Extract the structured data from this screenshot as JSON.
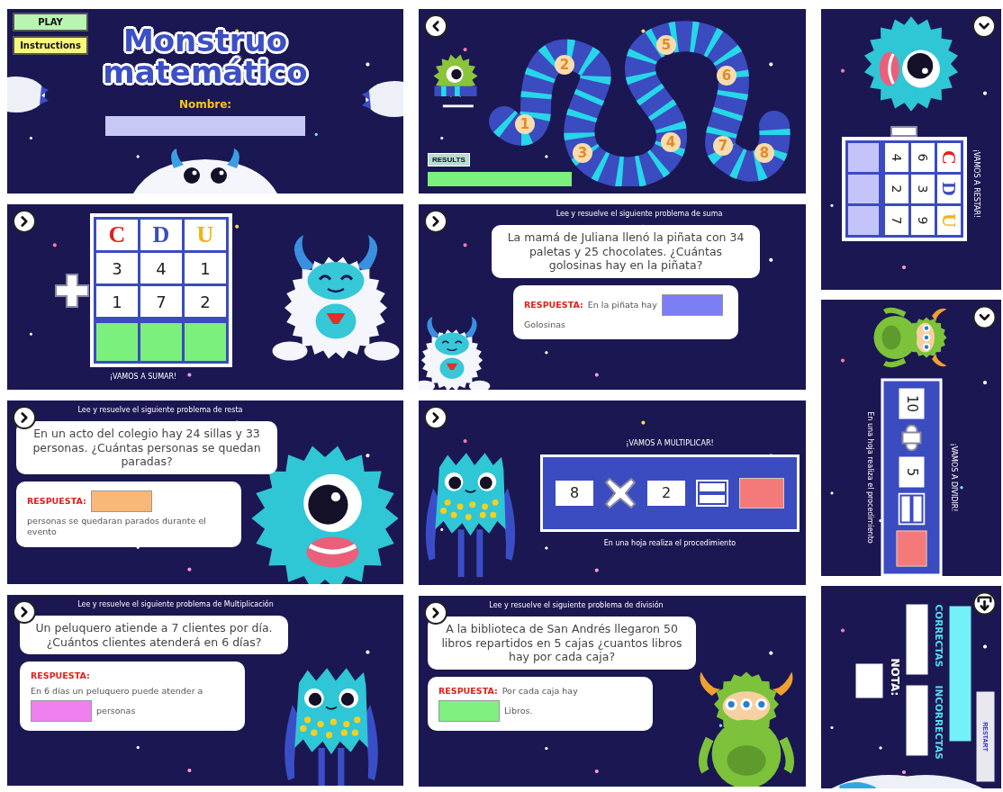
{
  "columns": [
    [
      {
        "kind": "title",
        "rotated": false,
        "buttons": [
          {
            "label": "PLAY",
            "color": "#b8f5b0"
          },
          {
            "label": "Instructions",
            "color": "#f8f87a"
          }
        ],
        "title_lines": [
          "Monstruo",
          "matemático"
        ],
        "field_label": "Nombre:"
      },
      {
        "kind": "column_operation",
        "rotated": false,
        "nav": {
          "kind": "next"
        },
        "operator": {
          "kind": "plus"
        },
        "place_values": [
          {
            "letter": "C",
            "color": "#e0201c",
            "digits": [
              "3",
              "1"
            ]
          },
          {
            "letter": "D",
            "color": "#3b4bc0",
            "digits": [
              "4",
              "7"
            ]
          },
          {
            "letter": "U",
            "color": "#f2b400",
            "digits": [
              "1",
              "2"
            ]
          }
        ],
        "answer_box": {
          "color": "#7cf07c"
        },
        "caption": "¡VAMOS A SUMAR!"
      },
      {
        "kind": "word_problem",
        "rotated": false,
        "nav": {
          "kind": "next"
        },
        "instruction": "Lee y resuelve el siguiente problema de resta",
        "question": "En un acto del colegio hay 24 sillas y 33 personas. ¿Cuántas personas se quedan paradas?",
        "answer_label": "RESPUESTA:",
        "answer_after": "personas se quedaran parados durante el evento",
        "answer_box": {
          "color": "#f8b878"
        }
      },
      {
        "kind": "word_problem",
        "rotated": false,
        "nav": {
          "kind": "next"
        },
        "instruction": "Lee y resuelve el siguiente problema de Multiplicación",
        "question": "Un peluquero atiende a 7 clientes por día. ¿Cuántos clientes atenderá en 6 días?",
        "answer_label": "RESPUESTA:",
        "answer_before": "En 6 días un peluquero puede atender a",
        "answer_after": "personas",
        "answer_box": {
          "color": "#f080f0"
        }
      }
    ],
    [
      {
        "kind": "map",
        "rotated": false,
        "nav": {
          "kind": "back"
        },
        "steps": [
          "1",
          "2",
          "3",
          "4",
          "5",
          "6",
          "7",
          "8"
        ],
        "button": "RESULTS"
      },
      {
        "kind": "word_problem",
        "rotated": false,
        "nav": {
          "kind": "next"
        },
        "instruction": "Lee y resuelve el siguiente problema de suma",
        "question": "La mamá de Juliana llenó la piñata con 34 paletas y 25 chocolates. ¿Cuántas golosinas hay en la piñata?",
        "answer_label": "RESPUESTA:",
        "answer_before": "En la piñata hay",
        "answer_after": "Golosinas",
        "answer_box": {
          "color": "#7b7ef5"
        }
      },
      {
        "kind": "inline_operation",
        "rotated": false,
        "nav": {
          "kind": "next"
        },
        "caption": "¡VAMOS A MULTIPLICAR!",
        "operands": [
          "8",
          "2"
        ],
        "operator": {
          "kind": "times"
        },
        "answer_box": {
          "color": "#f47a7a"
        },
        "footer": "En una hoja realiza el procedimiento"
      },
      {
        "kind": "word_problem",
        "rotated": false,
        "nav": {
          "kind": "next"
        },
        "instruction": "Lee y resuelve el siguiente problema de división",
        "question": "A la biblioteca de San Andrés llegaron 50 libros repartidos en 5 cajas ¿cuantos libros hay por cada caja?",
        "answer_label": "RESPUESTA:",
        "answer_before": "Por cada caja hay",
        "answer_after": "Libros.",
        "answer_box": {
          "color": "#80f080"
        }
      }
    ],
    [
      {
        "kind": "column_operation",
        "rotated": true,
        "nav": {
          "kind": "next"
        },
        "operator": {
          "kind": "minus"
        },
        "place_values": [
          {
            "letter": "C",
            "color": "#e0201c",
            "digits": [
              "6",
              "4"
            ]
          },
          {
            "letter": "D",
            "color": "#3b4bc0",
            "digits": [
              "3",
              "2"
            ]
          },
          {
            "letter": "U",
            "color": "#f2b400",
            "digits": [
              "9",
              "7"
            ]
          }
        ],
        "answer_box": {
          "color": "#c4c4fa"
        },
        "caption": "¡VAMOS A RESTAR!"
      },
      {
        "kind": "inline_operation",
        "rotated": true,
        "nav": {
          "kind": "next"
        },
        "caption": "¡VAMOS A DIVIDIR!",
        "operands": [
          "10",
          "5"
        ],
        "operator": {
          "kind": "divide"
        },
        "answer_box": {
          "color": "#f47a7a"
        },
        "footer": "En una hoja realiza el procedimiento"
      },
      {
        "kind": "results",
        "rotated": true,
        "nav": {
          "kind": "exit"
        },
        "labels": [
          "CORRECTAS",
          "INCORRECTAS"
        ],
        "grade_label": "NOTA:",
        "button": "RESTART"
      }
    ]
  ]
}
